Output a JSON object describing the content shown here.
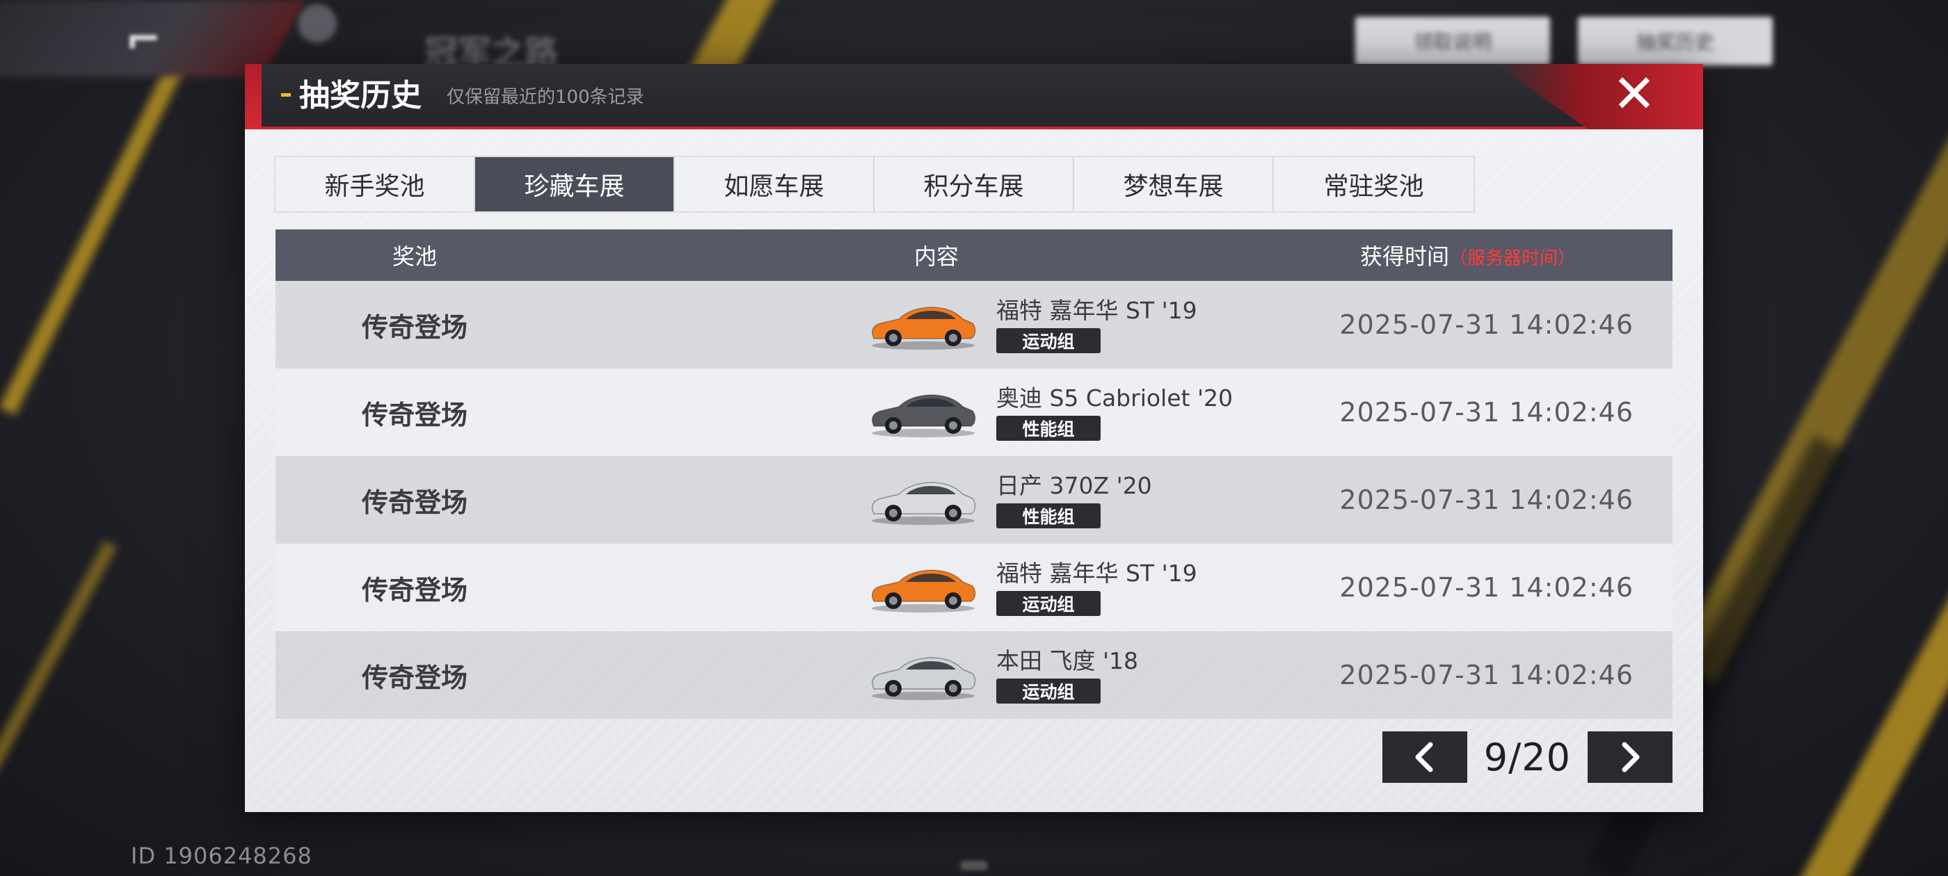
{
  "background": {
    "breadcrumb": "冠军之路",
    "top_buttons": [
      "领取说明",
      "抽奖历史"
    ],
    "user_id": "ID 1906248268"
  },
  "modal": {
    "title": "抽奖历史",
    "subtitle": "仅保留最近的100条记录",
    "close_symbol": "✕"
  },
  "tabs": [
    {
      "label": "新手奖池",
      "active": false
    },
    {
      "label": "珍藏车展",
      "active": true
    },
    {
      "label": "如愿车展",
      "active": false
    },
    {
      "label": "积分车展",
      "active": false
    },
    {
      "label": "梦想车展",
      "active": false
    },
    {
      "label": "常驻奖池",
      "active": false
    }
  ],
  "table": {
    "headers": {
      "pool": "奖池",
      "content": "内容",
      "time": "获得时间",
      "time_note": "（服务器时间）"
    },
    "rows": [
      {
        "pool": "传奇登场",
        "car": "福特 嘉年华 ST '19",
        "badge": "运动组",
        "car_color": "#f07a1e",
        "time": "2025-07-31 14:02:46"
      },
      {
        "pool": "传奇登场",
        "car": "奥迪 S5 Cabriolet '20",
        "badge": "性能组",
        "car_color": "#55575c",
        "time": "2025-07-31 14:02:46"
      },
      {
        "pool": "传奇登场",
        "car": "日产 370Z '20",
        "badge": "性能组",
        "car_color": "#d9dbde",
        "time": "2025-07-31 14:02:46"
      },
      {
        "pool": "传奇登场",
        "car": "福特 嘉年华 ST '19",
        "badge": "运动组",
        "car_color": "#f07a1e",
        "time": "2025-07-31 14:02:46"
      },
      {
        "pool": "传奇登场",
        "car": "本田 飞度 '18",
        "badge": "运动组",
        "car_color": "#cfd2d6",
        "time": "2025-07-31 14:02:46"
      }
    ]
  },
  "pagination": {
    "text": "9/20"
  },
  "colors": {
    "accent_red": "#c62430",
    "active_tab": "#4a4c57",
    "header_bar": "#575966",
    "title_dash": "#f2b62d"
  }
}
